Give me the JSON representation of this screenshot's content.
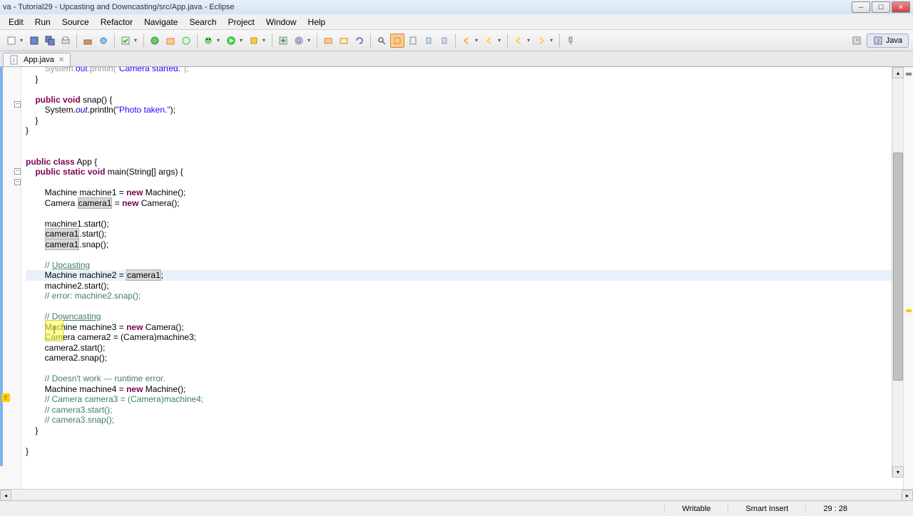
{
  "window": {
    "title": "va - Tutorial29 - Upcasting and Downcasting/src/App.java - Eclipse"
  },
  "menu": {
    "items": [
      "Edit",
      "Run",
      "Source",
      "Refactor",
      "Navigate",
      "Search",
      "Project",
      "Window",
      "Help"
    ]
  },
  "perspective": {
    "label": "Java"
  },
  "tab": {
    "filename": "App.java"
  },
  "code": {
    "lines": [
      {
        "t": "plain",
        "c": "        System.out.println(\"Camera started.\");",
        "partial": true
      },
      {
        "t": "plain",
        "c": "    }"
      },
      {
        "t": "empty",
        "c": ""
      },
      {
        "t": "method",
        "prefix": "    ",
        "kw1": "public",
        "kw2": "void",
        "name": " snap() {"
      },
      {
        "t": "print",
        "prefix": "        System.",
        "out": "out",
        "mid": ".println(",
        "str": "\"Photo taken.\"",
        "end": ");"
      },
      {
        "t": "plain",
        "c": "    }"
      },
      {
        "t": "plain",
        "c": "}"
      },
      {
        "t": "empty",
        "c": ""
      },
      {
        "t": "empty",
        "c": ""
      },
      {
        "t": "class",
        "prefix": "",
        "kw1": "public",
        "kw2": "class",
        "name": " App {"
      },
      {
        "t": "main",
        "prefix": "    ",
        "kw1": "public",
        "kw2": "static",
        "kw3": "void",
        "name": " main(String[] args) {"
      },
      {
        "t": "empty",
        "c": ""
      },
      {
        "t": "new",
        "prefix": "        Machine machine1 = ",
        "kw": "new",
        "rest": " Machine();"
      },
      {
        "t": "newocc",
        "prefix": "        Camera ",
        "occ": "camera1",
        "mid": " = ",
        "kw": "new",
        "rest": " Camera();"
      },
      {
        "t": "empty",
        "c": ""
      },
      {
        "t": "plain",
        "c": "        machine1.start();"
      },
      {
        "t": "occline",
        "prefix": "        ",
        "occ": "camera1",
        "rest": ".start();"
      },
      {
        "t": "occline",
        "prefix": "        ",
        "occ": "camera1",
        "rest": ".snap();"
      },
      {
        "t": "empty",
        "c": ""
      },
      {
        "t": "com",
        "c": "        // Upcasting",
        "u": "Upcasting"
      },
      {
        "t": "current",
        "prefix": "        Machine machine2 = ",
        "cur": "",
        "occ": "camera1",
        "rest": ";"
      },
      {
        "t": "plain",
        "c": "        machine2.start();"
      },
      {
        "t": "comfull",
        "c": "        // error: machine2.snap();"
      },
      {
        "t": "empty",
        "c": ""
      },
      {
        "t": "com",
        "c": "        // Downcasting",
        "u": "Downcasting"
      },
      {
        "t": "new",
        "prefix": "        Machine machine3 = ",
        "kw": "new",
        "rest": " Camera();"
      },
      {
        "t": "plain",
        "c": "        Camera camera2 = (Camera)machine3;"
      },
      {
        "t": "plain",
        "c": "        camera2.start();"
      },
      {
        "t": "plain",
        "c": "        camera2.snap();"
      },
      {
        "t": "empty",
        "c": ""
      },
      {
        "t": "comfull",
        "c": "        // Doesn't work --- runtime error."
      },
      {
        "t": "new",
        "prefix": "        Machine machine4 = ",
        "kw": "new",
        "rest": " Machine();"
      },
      {
        "t": "comfull",
        "c": "        // Camera camera3 = (Camera)machine4;"
      },
      {
        "t": "comfull",
        "c": "        // camera3.start();"
      },
      {
        "t": "comfull",
        "c": "        // camera3.snap();"
      },
      {
        "t": "plain",
        "c": "    }"
      },
      {
        "t": "empty",
        "c": ""
      },
      {
        "t": "plain",
        "c": "}"
      }
    ]
  },
  "status": {
    "writable": "Writable",
    "insert": "Smart Insert",
    "position": "29 : 28"
  },
  "icons": {
    "min": "─",
    "max": "☐",
    "close": "✕"
  }
}
